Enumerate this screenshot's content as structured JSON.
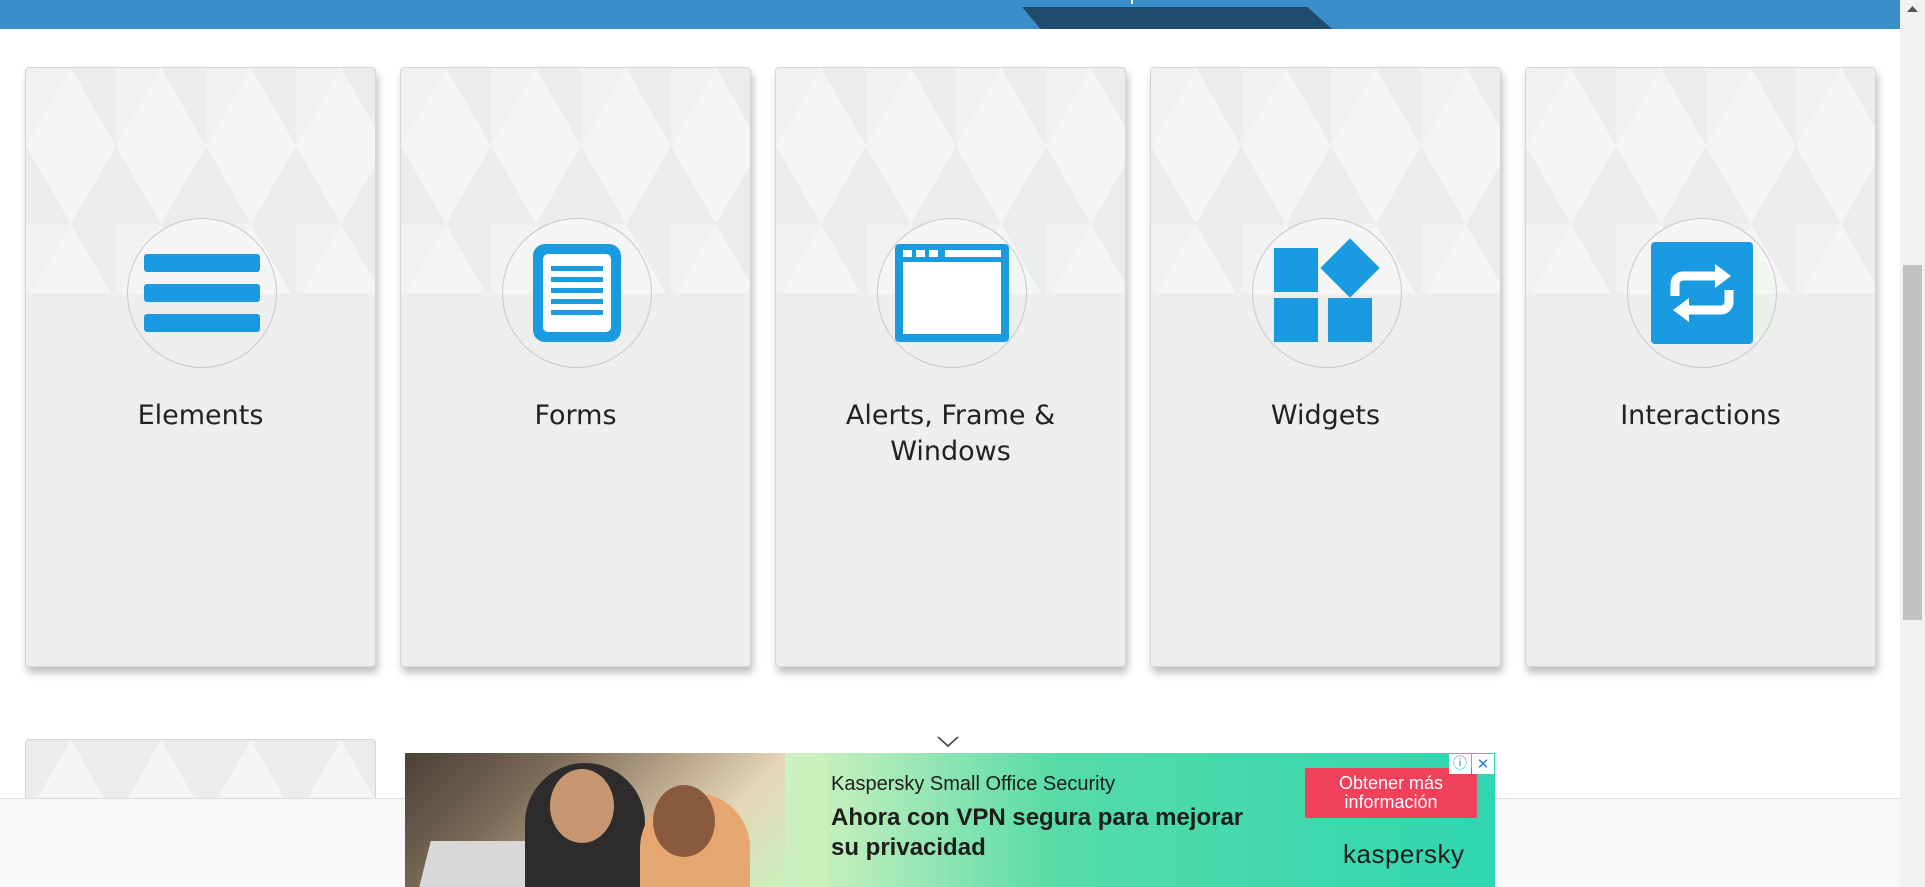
{
  "cards": [
    {
      "title": "Elements",
      "icon": "hamburger-list-icon"
    },
    {
      "title": "Forms",
      "icon": "document-form-icon"
    },
    {
      "title": "Alerts, Frame & Windows",
      "icon": "browser-window-icon"
    },
    {
      "title": "Widgets",
      "icon": "widgets-blocks-icon"
    },
    {
      "title": "Interactions",
      "icon": "interactions-arrows-icon"
    }
  ],
  "colors": {
    "accent": "#1a9ae0",
    "top_bar": "#3a8ec9",
    "top_bar_tab": "#1f4c6e",
    "card_background": "#eeeeee",
    "ad_cta": "#f0405a"
  },
  "ad": {
    "brand_line": "Kaspersky Small Office Security",
    "headline": "Ahora con VPN segura para mejorar su privacidad",
    "cta_label": "Obtener más información",
    "logo_text": "kaspersky",
    "info_icon": "info-icon",
    "close_icon": "close-icon"
  },
  "icons": {
    "collapse": "chevron-down-icon",
    "scroll_up": "scroll-up-arrow-icon"
  }
}
